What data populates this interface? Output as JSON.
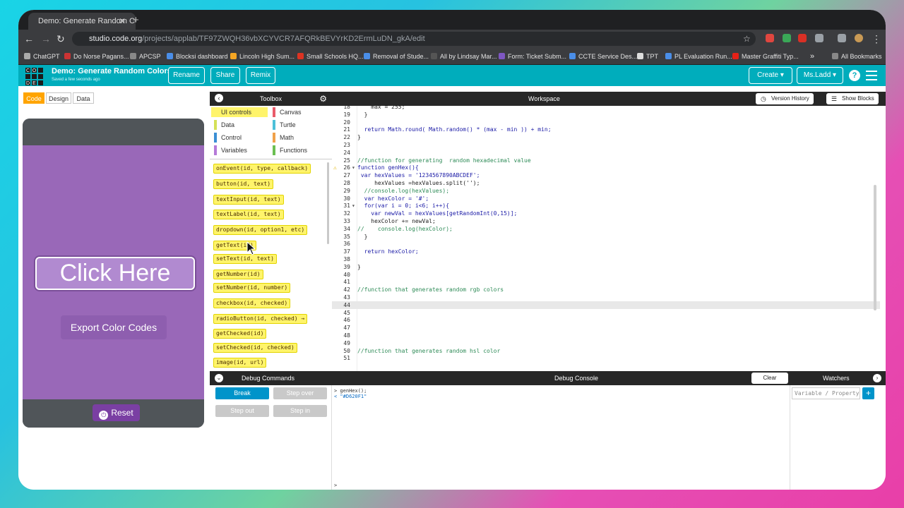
{
  "browser": {
    "tab_title": "Demo: Generate Random Co",
    "tab_close": "✕",
    "new_tab": "+",
    "url_host": "studio.code.org",
    "url_path": "/projects/applab/TF97ZWQH36vbXCYVCR7AFQRkBEVYrKD2ErmLuDN_gkA/edit",
    "bookmarks": [
      "ChatGPT",
      "Do Norse Pagans...",
      "APCSP",
      "Blocksi dashboard",
      "Lincoln High Sum...",
      "Small Schools HQ...",
      "Removal of Stude...",
      "All by Lindsay Mar...",
      "Form: Ticket Subm...",
      "CCTE Service Des...",
      "TPT",
      "PL Evaluation Run...",
      "Master Graffiti Typ...",
      "All Bookmarks"
    ],
    "bookmark_more": "»"
  },
  "header": {
    "logo_letters": [
      "C",
      "O",
      "D",
      "E",
      "",
      "",
      "",
      "",
      ""
    ],
    "project_title": "Demo: Generate Random Colors",
    "saved_text": "Saved a few seconds ago",
    "rename_label": "Rename",
    "share_label": "Share",
    "remix_label": "Remix",
    "create_label": "Create ▾",
    "user_label": "Ms.Ladd ▾",
    "help_label": "?"
  },
  "left": {
    "tabs": [
      "Code",
      "Design",
      "Data"
    ],
    "click_button_label": "Click Here",
    "export_button_label": "Export Color Codes",
    "reset_label": "Reset"
  },
  "toolbox": {
    "title": "Toolbox",
    "categories": [
      {
        "label": "UI controls",
        "color": "#fff46b"
      },
      {
        "label": "Canvas",
        "color": "#e95b6a"
      },
      {
        "label": "Data",
        "color": "#d4e157"
      },
      {
        "label": "Turtle",
        "color": "#4dc0d9"
      },
      {
        "label": "Control",
        "color": "#3b8fd4"
      },
      {
        "label": "Math",
        "color": "#f0a14a"
      },
      {
        "label": "Variables",
        "color": "#b57ad8"
      },
      {
        "label": "Functions",
        "color": "#6bbf52"
      }
    ],
    "blocks": [
      "onEvent(id, type, callback)",
      "button(id, text)",
      "textInput(id, text)",
      "textLabel(id, text)",
      "dropdown(id, option1, etc)",
      "getText(id)",
      "setText(id, text)",
      "getNumber(id)",
      "setNumber(id, number)",
      "checkbox(id, checked)",
      "radioButton(id, checked) →",
      "getChecked(id)",
      "setChecked(id, checked)",
      "image(id, url)"
    ]
  },
  "workspace": {
    "title": "Workspace",
    "version_history_label": "Version History",
    "show_blocks_label": "Show Blocks",
    "lines": [
      {
        "n": "18",
        "code": "    max = 255;"
      },
      {
        "n": "19",
        "code": "  }"
      },
      {
        "n": "20",
        "code": ""
      },
      {
        "n": "21",
        "code": "  return Math.round( Math.random() * (max - min )) + min;"
      },
      {
        "n": "22",
        "code": "}"
      },
      {
        "n": "23",
        "code": ""
      },
      {
        "n": "24",
        "code": ""
      },
      {
        "n": "25",
        "code": "//function for generating  random hexadecimal value"
      },
      {
        "n": "26",
        "code": "function genHex(){"
      },
      {
        "n": "27",
        "code": " var hexValues = '1234567890ABCDEF';"
      },
      {
        "n": "28",
        "code": "     hexValues =hexValues.split('');"
      },
      {
        "n": "29",
        "code": "  //console.log(hexValues);"
      },
      {
        "n": "30",
        "code": "  var hexColor = '#';"
      },
      {
        "n": "31",
        "code": "  for(var i = 0; i<6; i++){"
      },
      {
        "n": "32",
        "code": "    var newVal = hexValues[getRandomInt(0,15)];"
      },
      {
        "n": "33",
        "code": "    hexColor += newVal;"
      },
      {
        "n": "34",
        "code": "//    console.log(hexColor);"
      },
      {
        "n": "35",
        "code": "  }"
      },
      {
        "n": "36",
        "code": ""
      },
      {
        "n": "37",
        "code": "  return hexColor;"
      },
      {
        "n": "38",
        "code": ""
      },
      {
        "n": "39",
        "code": "}"
      },
      {
        "n": "40",
        "code": ""
      },
      {
        "n": "41",
        "code": ""
      },
      {
        "n": "42",
        "code": "//function that generates random rgb colors"
      },
      {
        "n": "43",
        "code": ""
      },
      {
        "n": "44",
        "code": ""
      },
      {
        "n": "45",
        "code": ""
      },
      {
        "n": "46",
        "code": ""
      },
      {
        "n": "47",
        "code": ""
      },
      {
        "n": "48",
        "code": ""
      },
      {
        "n": "49",
        "code": ""
      },
      {
        "n": "50",
        "code": "//function that generates random hsl color"
      },
      {
        "n": "51",
        "code": ""
      }
    ],
    "active_line": "44",
    "warning_line": "26",
    "fold_lines": [
      "26",
      "31"
    ]
  },
  "debug": {
    "commands_title": "Debug Commands",
    "break_label": "Break",
    "step_over_label": "Step over",
    "step_out_label": "Step out",
    "step_in_label": "Step in",
    "console_title": "Debug Console",
    "clear_label": "Clear",
    "console_lines": [
      "> genHex();",
      "< \"#D620F1\""
    ],
    "console_prompt": ">",
    "watchers_title": "Watchers",
    "watch_placeholder": "Variable / Property",
    "watch_add": "+"
  },
  "colors": {
    "header_bg": "#00adbc",
    "app_screen_bg": "#9968b8",
    "block_yellow": "#fff46b",
    "break_button": "#0094ca",
    "reset_button": "#7a3fa3"
  }
}
